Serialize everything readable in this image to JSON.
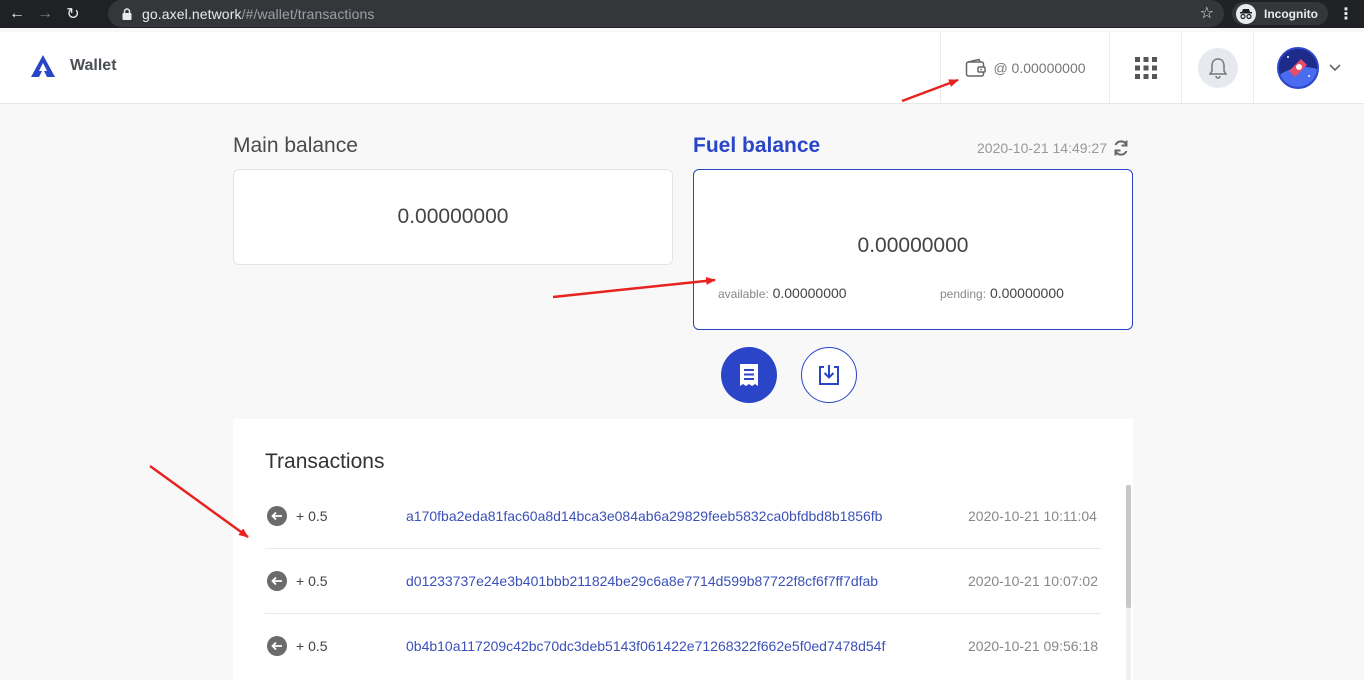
{
  "browser": {
    "url_host": "go.axel.network",
    "url_path": "/#/wallet/transactions",
    "profile_label": "Incognito"
  },
  "header": {
    "brand_title": "Wallet",
    "wallet_amount": "@ 0.00000000",
    "icons": [
      "wallet-icon",
      "apps-grid-icon",
      "bell-icon",
      "avatar",
      "chevron-down-icon"
    ]
  },
  "balances": {
    "main_title": "Main balance",
    "main_value": "0.00000000",
    "fuel_title": "Fuel balance",
    "updated_at": "2020-10-21 14:49:27",
    "fuel_value": "0.00000000",
    "available_label": "available:",
    "available_value": "0.00000000",
    "pending_label": "pending:",
    "pending_value": "0.00000000"
  },
  "transactions": {
    "title": "Transactions",
    "rows": [
      {
        "amount": "+ 0.5",
        "hash": "a170fba2eda81fac60a8d14bca3e084ab6a29829feeb5832ca0bfdbd8b1856fb",
        "time": "2020-10-21 10:11:04"
      },
      {
        "amount": "+ 0.5",
        "hash": "d01233737e24e3b401bbb211824be29c6a8e7714d599b87722f8cf6f7ff7dfab",
        "time": "2020-10-21 10:07:02"
      },
      {
        "amount": "+ 0.5",
        "hash": "0b4b10a117209c42bc70dc3deb5143f061422e71268322f662e5f0ed7478d54f",
        "time": "2020-10-21 09:56:18"
      }
    ]
  },
  "colors": {
    "accent": "#2a45c7",
    "annotation": "#e8231f",
    "chrome": "#202124"
  }
}
